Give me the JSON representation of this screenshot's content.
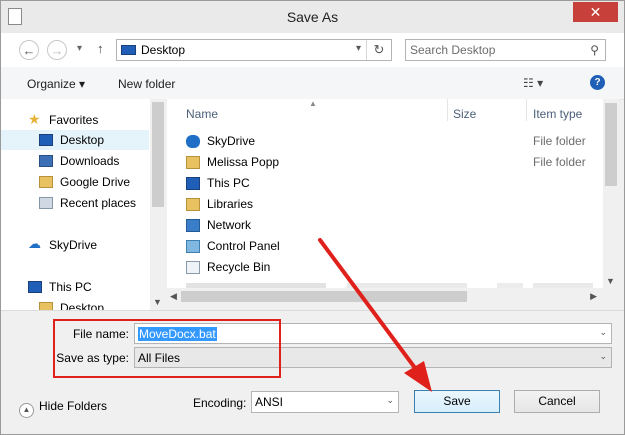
{
  "window": {
    "title": "Save As",
    "close_glyph": "✕"
  },
  "nav": {
    "back_glyph": "←",
    "forward_glyph": "→",
    "history_glyph": "▾",
    "up_glyph": "↑",
    "address": "Desktop",
    "address_dropdown_glyph": "▾",
    "refresh_glyph": "↻",
    "search_placeholder": "Search Desktop",
    "search_glyph": "⚲"
  },
  "toolbar": {
    "organize": "Organize ▾",
    "new_folder": "New folder",
    "view_glyph": "☷  ▾",
    "help_glyph": "?"
  },
  "sidebar": {
    "favorites": "Favorites",
    "items": [
      {
        "label": "Desktop",
        "icon": "desktop-icon",
        "selected": true
      },
      {
        "label": "Downloads",
        "icon": "downloads-icon"
      },
      {
        "label": "Google Drive",
        "icon": "google-drive-icon"
      },
      {
        "label": "Recent places",
        "icon": "recent-places-icon"
      }
    ],
    "skydrive": "SkyDrive",
    "thispc": "This PC",
    "sub_desktop": "Desktop"
  },
  "columns": {
    "name": "Name",
    "size": "Size",
    "type": "Item type"
  },
  "files": [
    {
      "name": "SkyDrive",
      "type": "File folder",
      "icon": "skydrive-folder-icon"
    },
    {
      "name": "Melissa Popp",
      "type": "File folder",
      "icon": "user-folder-icon"
    },
    {
      "name": "This PC",
      "type": "",
      "icon": "this-pc-icon"
    },
    {
      "name": "Libraries",
      "type": "",
      "icon": "libraries-icon"
    },
    {
      "name": "Network",
      "type": "",
      "icon": "network-icon"
    },
    {
      "name": "Control Panel",
      "type": "",
      "icon": "control-panel-icon"
    },
    {
      "name": "Recycle Bin",
      "type": "",
      "icon": "recycle-bin-icon"
    }
  ],
  "form": {
    "filename_label": "File name:",
    "filename_value": "MoveDocx.bat",
    "type_label": "Save as type:",
    "type_value": "All Files",
    "dropdown_glyph": "⌄"
  },
  "bottom": {
    "hide_folders": "Hide Folders",
    "hide_glyph": "▲",
    "encoding_label": "Encoding:",
    "encoding_value": "ANSI",
    "save": "Save",
    "cancel": "Cancel"
  },
  "colors": {
    "accent": "#3399ff",
    "annotation": "#e0201b"
  }
}
